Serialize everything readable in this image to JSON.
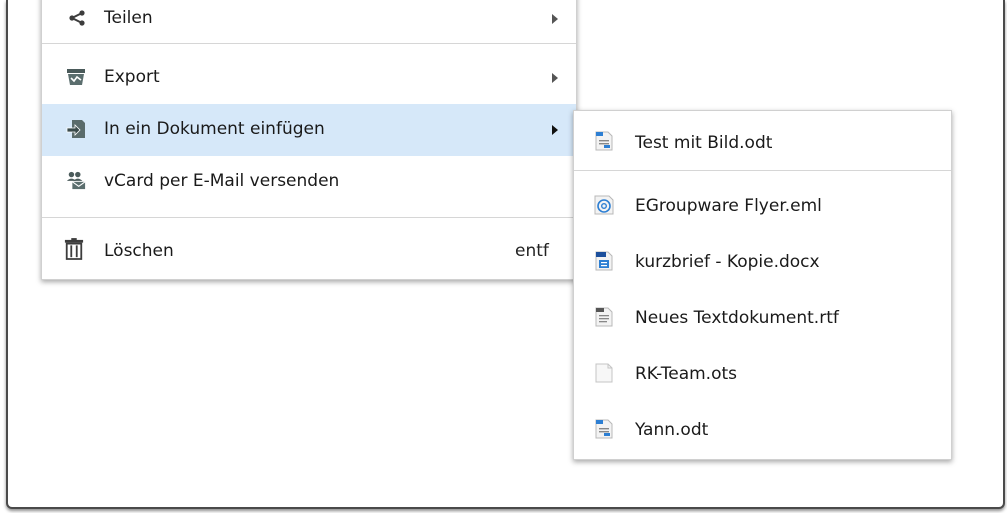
{
  "context_menu": {
    "items": [
      {
        "label": "Teilen",
        "icon": "share-icon",
        "has_submenu": true
      },
      {
        "label": "Export",
        "icon": "export-icon",
        "has_submenu": true
      },
      {
        "label": "In ein Dokument einfügen",
        "icon": "insert-document-icon",
        "has_submenu": true,
        "active": true
      },
      {
        "label": "vCard per E-Mail versenden",
        "icon": "vcard-mail-icon",
        "has_submenu": false
      },
      {
        "label": "Löschen",
        "icon": "trash-icon",
        "shortcut": "entf"
      }
    ]
  },
  "submenu": {
    "items": [
      {
        "label": "Test mit Bild.odt",
        "icon": "odt-file-icon"
      },
      {
        "label": "EGroupware Flyer.eml",
        "icon": "eml-file-icon"
      },
      {
        "label": "kurzbrief - Kopie.docx",
        "icon": "docx-file-icon"
      },
      {
        "label": "Neues Textdokument.rtf",
        "icon": "rtf-file-icon"
      },
      {
        "label": "RK-Team.ots",
        "icon": "ots-file-icon"
      },
      {
        "label": "Yann.odt",
        "icon": "odt-file-icon"
      }
    ]
  },
  "colors": {
    "active_highlight": "#d6e8f9",
    "separator": "#d6d6d6",
    "frame_border": "#4a4a4a"
  }
}
